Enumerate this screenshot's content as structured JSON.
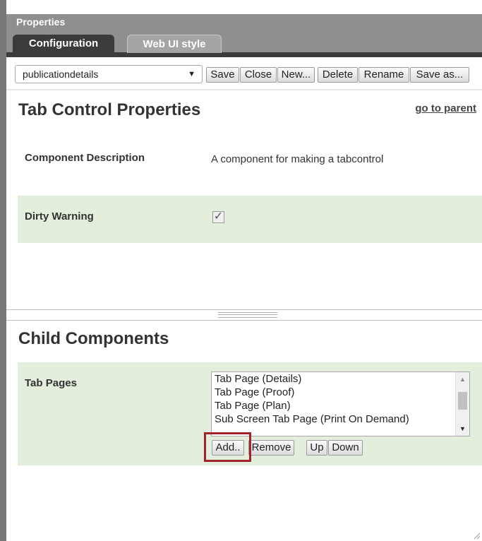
{
  "window": {
    "title": "Properties"
  },
  "tabs": [
    {
      "label": "Configuration",
      "active": true
    },
    {
      "label": "Web UI style",
      "active": false
    }
  ],
  "toolbar": {
    "selected_component": "publicationdetails",
    "buttons": [
      "Save",
      "Close",
      "New...",
      "Delete",
      "Rename",
      "Save as..."
    ]
  },
  "properties": {
    "heading": "Tab Control Properties",
    "go_to_parent": "go to parent",
    "rows": [
      {
        "label": "Component Description",
        "value": "A component for making a tabcontrol"
      },
      {
        "label": "Dirty Warning",
        "checked": true
      }
    ]
  },
  "child": {
    "heading": "Child Components",
    "label": "Tab Pages",
    "items": [
      "Tab Page (Details)",
      "Tab Page (Proof)",
      "Tab Page (Plan)",
      "Sub Screen Tab Page (Print On Demand)"
    ],
    "buttons": {
      "add": "Add..",
      "remove": "Remove",
      "up": "Up",
      "down": "Down"
    }
  },
  "colors": {
    "highlight": "#a3232d",
    "green_row": "#e3eedc",
    "header": "#8f8f8f",
    "tab_active": "#3b3b3b"
  },
  "icons": {
    "checkbox": "check-mark",
    "dropdown": "triangle-down"
  }
}
